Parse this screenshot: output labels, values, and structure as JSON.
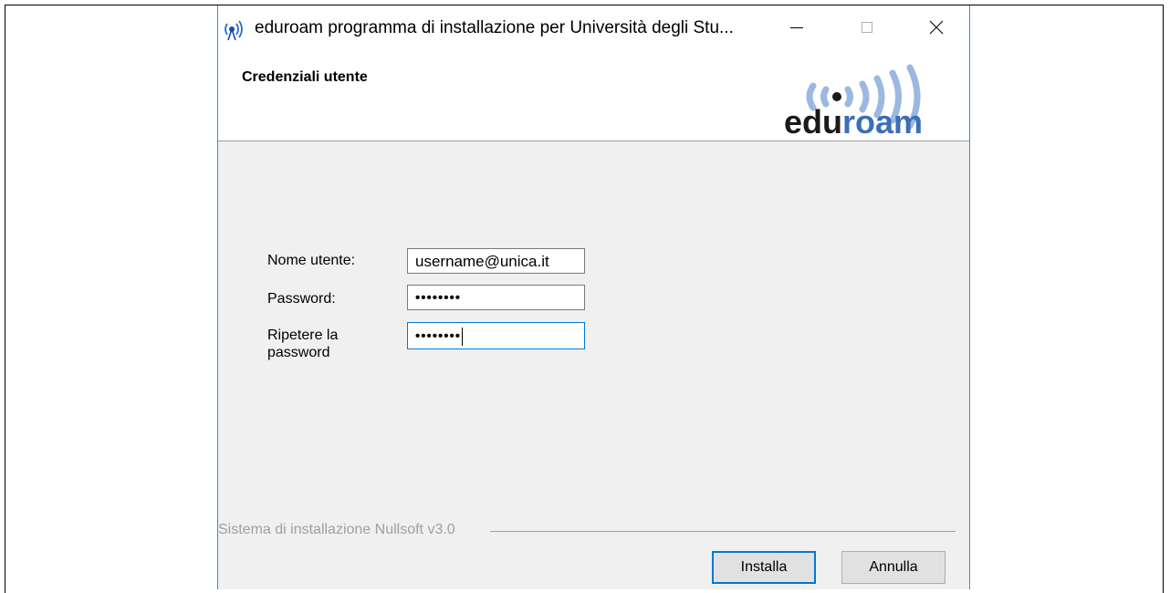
{
  "window": {
    "title": "eduroam programma di installazione per Università degli Stu...",
    "icon": "eduroam-antenna-icon"
  },
  "header": {
    "title": "Credenziali utente",
    "logo_text": "eduroam"
  },
  "form": {
    "username_label": "Nome utente:",
    "username_value": "username@unica.it",
    "password_label": "Password:",
    "password_value": "••••••••",
    "repeat_label_line1": "Ripetere la",
    "repeat_label_line2": "password",
    "repeat_value": "••••••••"
  },
  "footer": {
    "branding": "Sistema di installazione Nullsoft v3.0"
  },
  "buttons": {
    "install": "Installa",
    "cancel": "Annulla"
  },
  "colors": {
    "accent": "#0078d7",
    "logo_blue": "#7aa4d8",
    "logo_dark": "#1a1a1a",
    "logo_wave": "#9bb8e0"
  }
}
